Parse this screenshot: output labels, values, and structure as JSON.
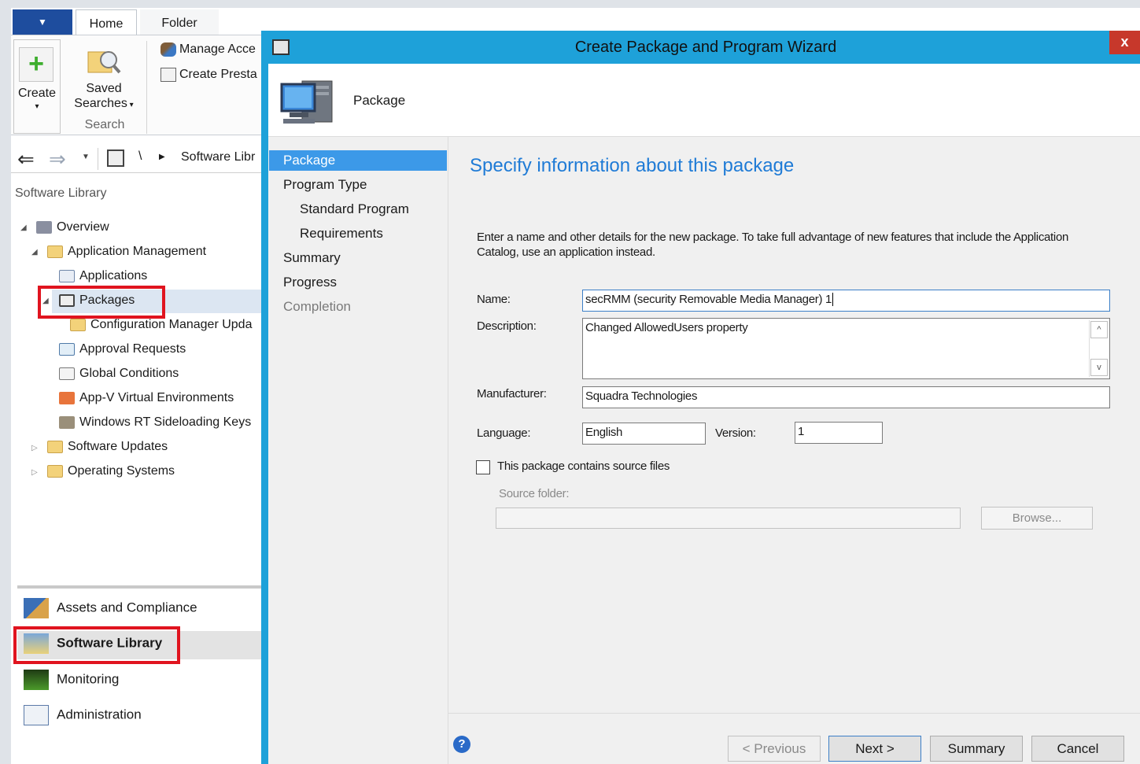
{
  "ribbon": {
    "tabs": [
      "Home",
      "Folder"
    ],
    "create_label": "Create",
    "saved_searches_label_1": "Saved",
    "saved_searches_label_2": "Searches",
    "search_group_label": "Search",
    "manage_access_label": "Manage Acce",
    "create_prestage_label": "Create Presta"
  },
  "navbar": {
    "path_root": "\\",
    "path_item": "Software Libr"
  },
  "tree": {
    "title": "Software Library",
    "items": [
      {
        "label": "Overview",
        "icon": "overview-icon"
      },
      {
        "label": "Application Management",
        "icon": "folder-icon"
      },
      {
        "label": "Applications",
        "icon": "applications-icon"
      },
      {
        "label": "Packages",
        "icon": "package-icon"
      },
      {
        "label": "Configuration Manager Upda",
        "icon": "folder-icon"
      },
      {
        "label": "Approval Requests",
        "icon": "approval-requests-icon"
      },
      {
        "label": "Global Conditions",
        "icon": "global-conditions-icon"
      },
      {
        "label": "App-V Virtual Environments",
        "icon": "appv-icon"
      },
      {
        "label": "Windows RT Sideloading Keys",
        "icon": "keys-icon"
      },
      {
        "label": "Software Updates",
        "icon": "folder-icon"
      },
      {
        "label": "Operating Systems",
        "icon": "folder-icon"
      }
    ]
  },
  "workspaces": [
    {
      "label": "Assets and Compliance",
      "icon": "assets-icon"
    },
    {
      "label": "Software Library",
      "icon": "software-library-icon"
    },
    {
      "label": "Monitoring",
      "icon": "monitoring-icon"
    },
    {
      "label": "Administration",
      "icon": "administration-icon"
    }
  ],
  "wizard": {
    "title": "Create Package and Program Wizard",
    "close_label": "x",
    "header_label": "Package",
    "steps": [
      {
        "label": "Package",
        "state": "active"
      },
      {
        "label": "Program Type",
        "state": "normal"
      },
      {
        "label": "Standard Program",
        "state": "sub"
      },
      {
        "label": "Requirements",
        "state": "sub"
      },
      {
        "label": "Summary",
        "state": "normal"
      },
      {
        "label": "Progress",
        "state": "normal"
      },
      {
        "label": "Completion",
        "state": "dim"
      }
    ],
    "heading": "Specify information about this package",
    "description": "Enter a name and other details for the new package. To take full advantage of new features that include the Application Catalog, use an application instead.",
    "fields": {
      "name_label": "Name:",
      "name_value": "secRMM (security Removable Media Manager) 1",
      "description_label": "Description:",
      "description_value": "Changed AllowedUsers property",
      "manufacturer_label": "Manufacturer:",
      "manufacturer_value": "Squadra Technologies",
      "language_label": "Language:",
      "language_value": "English",
      "version_label": "Version:",
      "version_value": "1",
      "source_checkbox_label": "This package contains source files",
      "source_checked": false,
      "source_folder_label": "Source folder:",
      "source_folder_value": "",
      "browse_label": "Browse..."
    },
    "buttons": {
      "previous": "< Previous",
      "next": "Next >",
      "summary": "Summary",
      "cancel": "Cancel"
    },
    "help_icon": "help-icon"
  },
  "colors": {
    "wizard_accent": "#1ea1d9",
    "active_step": "#3c99e8",
    "heading": "#1f7bd6",
    "highlight_box": "#e0141f",
    "close_button": "#c7382b"
  }
}
